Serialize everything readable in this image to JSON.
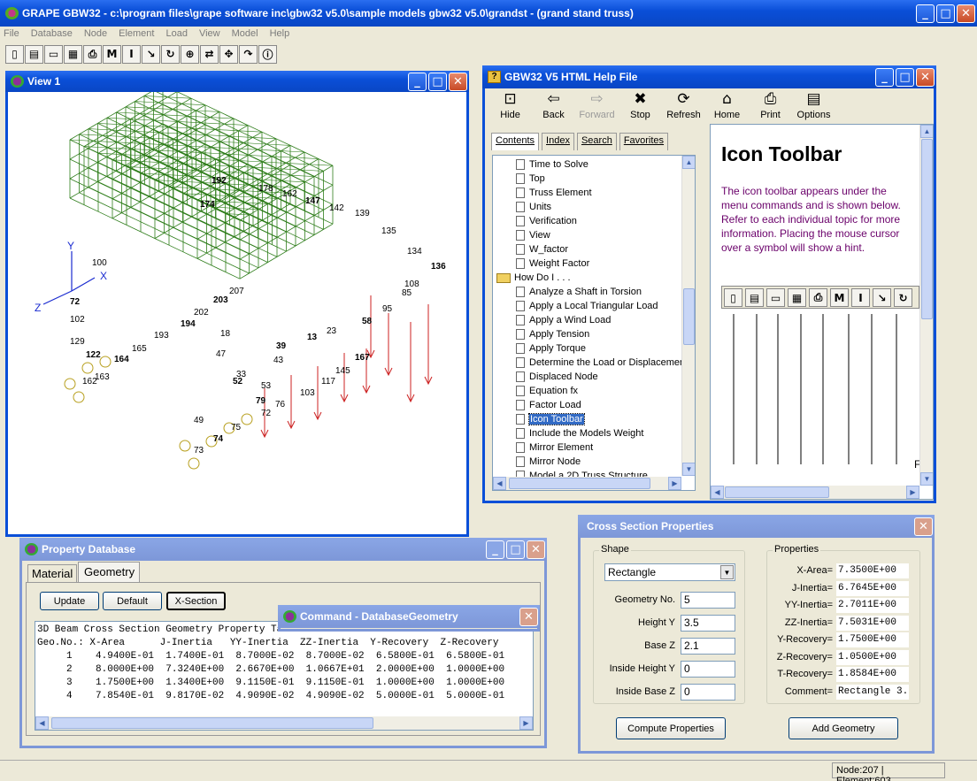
{
  "app": {
    "title": "GRAPE GBW32 - c:\\program files\\grape software inc\\gbw32 v5.0\\sample models gbw32 v5.0\\grandst - (grand stand truss)",
    "menu": [
      "File",
      "Database",
      "Node",
      "Element",
      "Load",
      "View",
      "Model",
      "Help"
    ],
    "toolbar_icons": [
      "new-icon",
      "open-icon",
      "copy-icon",
      "paste-icon",
      "print-icon",
      "m-icon",
      "i-icon",
      "hook-icon",
      "rotate-icon",
      "target-icon",
      "move-horizontal-icon",
      "move-icon",
      "curve-arrow-icon",
      "info-icon"
    ],
    "toolbar_glyphs": [
      "▯",
      "▤",
      "▭",
      "▦",
      "⎙",
      "M",
      "I",
      "↘",
      "↻",
      "⊕",
      "⇄",
      "✥",
      "↷",
      "ⓘ"
    ],
    "status": "Node:207 | Element:603"
  },
  "view1": {
    "title": "View 1",
    "node_labels": [
      "192",
      "178",
      "162",
      "147",
      "142",
      "139",
      "174",
      "135",
      "134",
      "136",
      "108",
      "95",
      "58",
      "85",
      "100",
      "72",
      "102",
      "129",
      "122",
      "163",
      "162",
      "164",
      "165",
      "193",
      "194",
      "202",
      "207",
      "203",
      "117",
      "145",
      "167",
      "103",
      "73",
      "74",
      "75",
      "76",
      "79",
      "72",
      "23",
      "13",
      "43",
      "49",
      "52",
      "53",
      "33",
      "39",
      "18",
      "47"
    ]
  },
  "help": {
    "title": "GBW32 V5 HTML Help File",
    "toolbar": [
      {
        "label": "Hide",
        "icon": "hide-icon",
        "glyph": "⊡",
        "disabled": false
      },
      {
        "label": "Back",
        "icon": "back-arrow-icon",
        "glyph": "⇦",
        "disabled": false
      },
      {
        "label": "Forward",
        "icon": "forward-arrow-icon",
        "glyph": "⇨",
        "disabled": true
      },
      {
        "label": "Stop",
        "icon": "stop-icon",
        "glyph": "✖",
        "disabled": false
      },
      {
        "label": "Refresh",
        "icon": "refresh-icon",
        "glyph": "⟳",
        "disabled": false
      },
      {
        "label": "Home",
        "icon": "home-icon",
        "glyph": "⌂",
        "disabled": false
      },
      {
        "label": "Print",
        "icon": "print-icon",
        "glyph": "⎙",
        "disabled": false
      },
      {
        "label": "Options",
        "icon": "options-icon",
        "glyph": "▤",
        "disabled": false
      }
    ],
    "tabs": [
      "Contents",
      "Index",
      "Search",
      "Favorites"
    ],
    "tree": [
      {
        "label": "Time to Solve",
        "folder": false
      },
      {
        "label": "Top",
        "folder": false
      },
      {
        "label": "Truss Element",
        "folder": false
      },
      {
        "label": "Units",
        "folder": false
      },
      {
        "label": "Verification",
        "folder": false
      },
      {
        "label": "View",
        "folder": false
      },
      {
        "label": "W_factor",
        "folder": false
      },
      {
        "label": "Weight Factor",
        "folder": false
      },
      {
        "label": "How Do I . . .",
        "folder": true
      },
      {
        "label": "Analyze a Shaft in Torsion",
        "folder": false
      },
      {
        "label": "Apply a Local Triangular Load",
        "folder": false
      },
      {
        "label": "Apply a Wind Load",
        "folder": false
      },
      {
        "label": "Apply Tension",
        "folder": false
      },
      {
        "label": "Apply Torque",
        "folder": false
      },
      {
        "label": "Determine the Load or Displacemen",
        "folder": false
      },
      {
        "label": "Displaced Node",
        "folder": false
      },
      {
        "label": "Equation fx",
        "folder": false
      },
      {
        "label": "Factor Load",
        "folder": false
      },
      {
        "label": "Icon Toolbar",
        "folder": false,
        "selected": true
      },
      {
        "label": "Include the Models Weight",
        "folder": false
      },
      {
        "label": "Mirror Element",
        "folder": false
      },
      {
        "label": "Mirror Node",
        "folder": false
      },
      {
        "label": "Model a 2D Truss Structure",
        "folder": false
      }
    ],
    "content_title": "Icon Toolbar",
    "content_body": "The icon toolbar appears under the menu commands and is shown below. Refer to each individual topic for more information. Placing the mouse cursor over a symbol will show a hint.",
    "content_cut_letter": "F"
  },
  "propdb": {
    "title": "Property Database",
    "tabs": [
      "Material",
      "Geometry"
    ],
    "buttons": [
      "Update",
      "Default",
      "X-Section"
    ],
    "table_title": "3D Beam Cross Section Geometry Property Table",
    "header": "Geo.No.: X-Area      J-Inertia   YY-Inertia  ZZ-Inertia  Y-Recovery  Z-Recovery",
    "rows": [
      "     1    4.9400E-01  1.7400E-01  8.7000E-02  8.7000E-02  6.5800E-01  6.5800E-01",
      "     2    8.0000E+00  7.3240E+00  2.6670E+00  1.0667E+01  2.0000E+00  1.0000E+00",
      "     3    1.7500E+00  1.3400E+00  9.1150E-01  9.1150E-01  1.0000E+00  1.0000E+00",
      "     4    7.8540E-01  9.8170E-02  4.9090E-02  4.9090E-02  5.0000E-01  5.0000E-01"
    ]
  },
  "command": {
    "title": "Command - DatabaseGeometry"
  },
  "xsec": {
    "title": "Cross Section Properties",
    "shape_group": "Shape",
    "shape_value": "Rectangle",
    "fields": [
      {
        "label": "Geometry No.",
        "value": "5"
      },
      {
        "label": "Height Y",
        "value": "3.5"
      },
      {
        "label": "Base Z",
        "value": "2.1"
      },
      {
        "label": "Inside Height Y",
        "value": "0"
      },
      {
        "label": "Inside Base Z",
        "value": "0"
      }
    ],
    "props_group": "Properties",
    "props": [
      {
        "label": "X-Area=",
        "value": "7.3500E+00"
      },
      {
        "label": "J-Inertia=",
        "value": "6.7645E+00"
      },
      {
        "label": "YY-Inertia=",
        "value": "2.7011E+00"
      },
      {
        "label": "ZZ-Inertia=",
        "value": "7.5031E+00"
      },
      {
        "label": "Y-Recovery=",
        "value": "1.7500E+00"
      },
      {
        "label": "Z-Recovery=",
        "value": "1.0500E+00"
      },
      {
        "label": "T-Recovery=",
        "value": "1.8584E+00"
      },
      {
        "label": "Comment=",
        "value": "Rectangle 3."
      }
    ],
    "compute_label": "Compute Properties",
    "add_label": "Add Geometry"
  },
  "colors": {
    "title_active": "#0a4fd8",
    "title_inactive": "#7d97d8",
    "truss": "#2e7d1a",
    "load": "#cc2222",
    "support": "#b8a020",
    "help_text": "#6a006a"
  }
}
